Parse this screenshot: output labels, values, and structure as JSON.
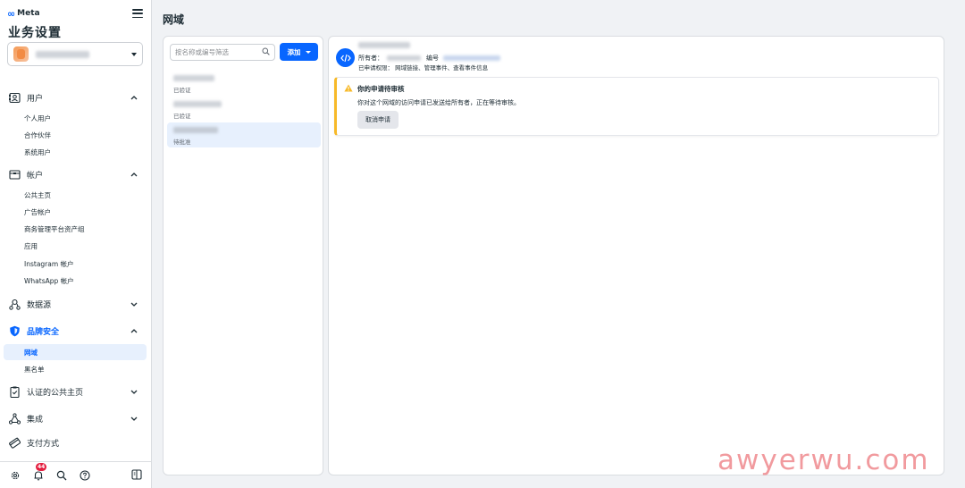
{
  "sidebar": {
    "brand": "Meta",
    "title": "业务设置",
    "groups": [
      {
        "label": "用户",
        "items": [
          "个人用户",
          "合作伙伴",
          "系统用户"
        ]
      },
      {
        "label": "帐户",
        "items": [
          "公共主页",
          "广告帐户",
          "商务管理平台资产组",
          "应用",
          "Instagram 帐户",
          "WhatsApp 帐户"
        ]
      },
      {
        "label": "数据源"
      },
      {
        "label": "品牌安全",
        "items": [
          "网域",
          "黑名单"
        ]
      },
      {
        "label": "认证的公共主页"
      },
      {
        "label": "集成"
      },
      {
        "label": "支付方式"
      }
    ],
    "notification_count": "44",
    "accent_color": "#0866ff"
  },
  "main": {
    "page_title": "网域",
    "search_placeholder": "按名称或编号筛选",
    "add_button": "添加",
    "domains": [
      {
        "status": "已验证"
      },
      {
        "status": "已验证"
      },
      {
        "status": "待批准"
      }
    ],
    "detail": {
      "owner_label": "所有者：",
      "id_label": "编号",
      "permissions": "已申请权限： 网域链接、管理事件、查看事件信息",
      "notice_title": "你的申请待审核",
      "notice_body": "你对这个网域的访问申请已发送给所有者，正在等待审核。",
      "cancel_button": "取消申请"
    }
  },
  "watermark": "awyerwu.com"
}
